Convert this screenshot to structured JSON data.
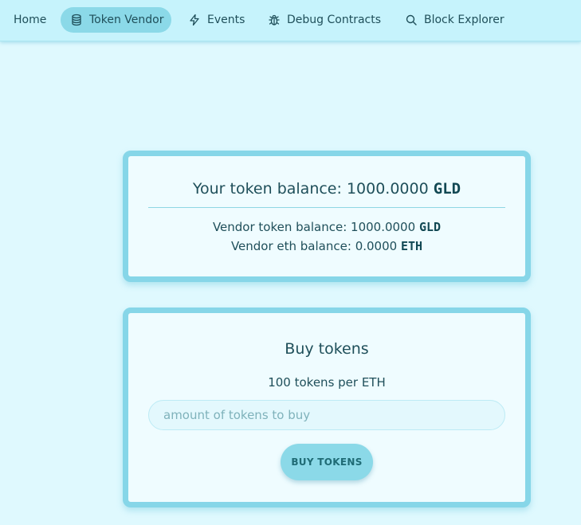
{
  "nav": {
    "home": "Home",
    "token_vendor": "Token Vendor",
    "events": "Events",
    "debug_contracts": "Debug Contracts",
    "block_explorer": "Block Explorer"
  },
  "balance": {
    "label": "Your token balance:",
    "amount": "1000.0000",
    "symbol": "GLD",
    "vendor_token_label": "Vendor token balance:",
    "vendor_token_amount": "1000.0000",
    "vendor_token_symbol": "GLD",
    "vendor_eth_label": "Vendor eth balance:",
    "vendor_eth_amount": "0.0000",
    "vendor_eth_symbol": "ETH"
  },
  "buy": {
    "title": "Buy tokens",
    "rate": "100 tokens per ETH",
    "input_placeholder": "amount of tokens to buy",
    "input_value": "",
    "button_label": "BUY TOKENS"
  },
  "colors": {
    "accent": "#8bd9e8",
    "background": "#dff9fe",
    "navbar": "#c6f3fc",
    "card_border": "#86d6e8",
    "text": "#1f4f5a"
  },
  "icons": {
    "token_vendor": "coins-stack-icon",
    "events": "bolt-icon",
    "debug_contracts": "bug-icon",
    "block_explorer": "search-icon"
  }
}
